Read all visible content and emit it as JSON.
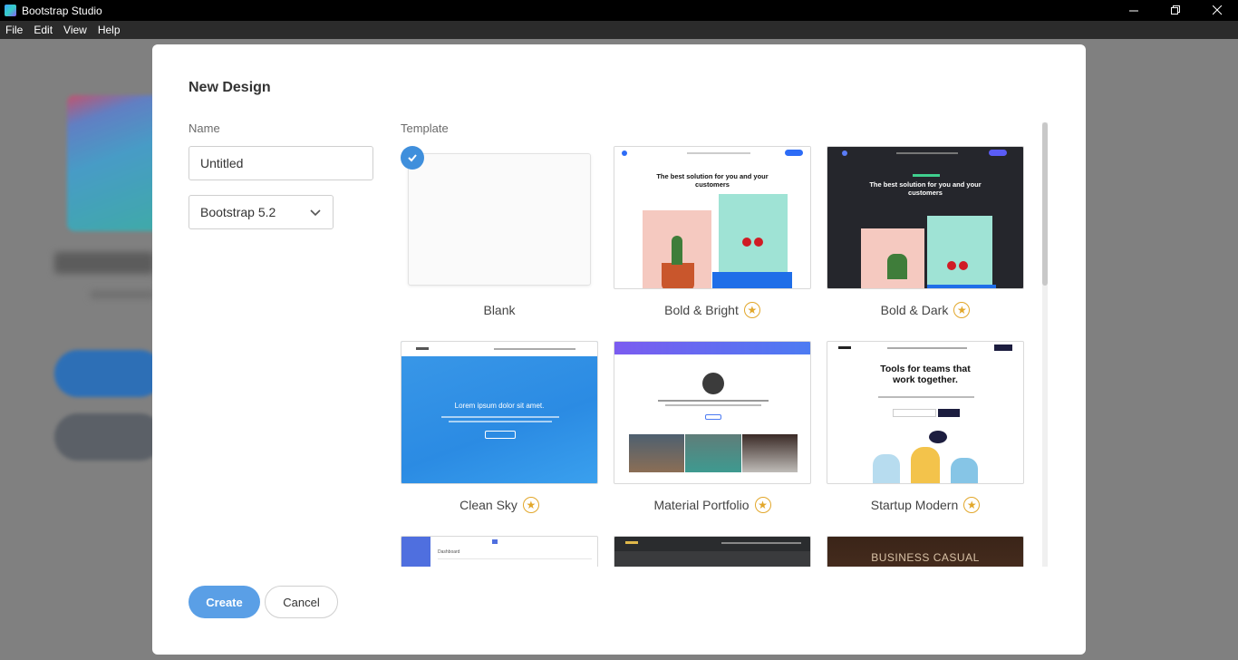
{
  "window": {
    "title": "Bootstrap Studio"
  },
  "menu": [
    "File",
    "Edit",
    "View",
    "Help"
  ],
  "dialog": {
    "title": "New Design",
    "name_label": "Name",
    "name_value": "Untitled",
    "framework_value": "Bootstrap 5.2",
    "template_label": "Template",
    "create_label": "Create",
    "cancel_label": "Cancel"
  },
  "templates": [
    {
      "label": "Blank",
      "premium": false,
      "selected": true
    },
    {
      "label": "Bold & Bright",
      "premium": true,
      "selected": false,
      "headline": "The best solution for you and your customers"
    },
    {
      "label": "Bold & Dark",
      "premium": true,
      "selected": false,
      "headline": "The best solution for you and your customers"
    },
    {
      "label": "Clean Sky",
      "premium": true,
      "selected": false,
      "headline": "Lorem ipsum dolor sit amet."
    },
    {
      "label": "Material Portfolio",
      "premium": true,
      "selected": false
    },
    {
      "label": "Startup Modern",
      "premium": true,
      "selected": false,
      "headline": "Tools for teams that work together."
    },
    {
      "label": "",
      "premium": false,
      "selected": false,
      "headline": "Dashboard"
    },
    {
      "label": "",
      "premium": false,
      "selected": false
    },
    {
      "label": "",
      "premium": false,
      "selected": false,
      "headline": "BUSINESS CASUAL"
    }
  ],
  "colors": {
    "accent": "#5a9fe6",
    "check": "#3f8fdc",
    "star": "#e2a72b"
  }
}
